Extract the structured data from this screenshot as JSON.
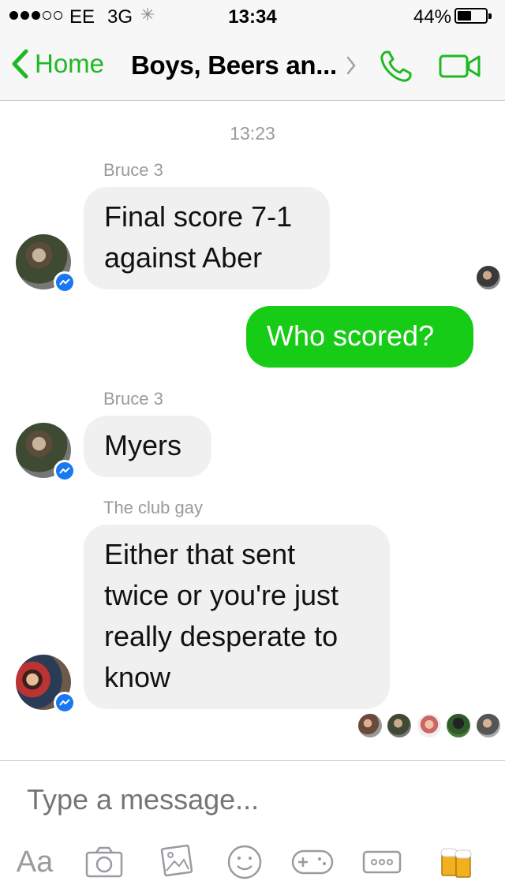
{
  "status_bar": {
    "carrier": "EE",
    "network": "3G",
    "time": "13:34",
    "battery": "44%",
    "battery_level": 0.44
  },
  "header": {
    "back_label": "Home",
    "title": "Boys, Beers an..."
  },
  "thread": {
    "timestamp": "13:23",
    "messages": [
      {
        "sender": "Bruce 3",
        "text": "Final score 7-1\nagainst Aber",
        "direction": "incoming"
      },
      {
        "text": "Who scored?",
        "direction": "outgoing"
      },
      {
        "sender": "Bruce 3",
        "text": "Myers",
        "direction": "incoming"
      },
      {
        "sender": "The club gay",
        "text": "Either that sent\ntwice or you're just\nreally desperate to\nknow",
        "direction": "incoming"
      }
    ]
  },
  "composer": {
    "placeholder": "Type a message...",
    "text_tool_label": "Aa"
  },
  "colors": {
    "accent": "#1fb922",
    "outgoing_bubble": "#17cc17",
    "incoming_bubble": "#f0f0f0",
    "badge": "#1877f2"
  }
}
